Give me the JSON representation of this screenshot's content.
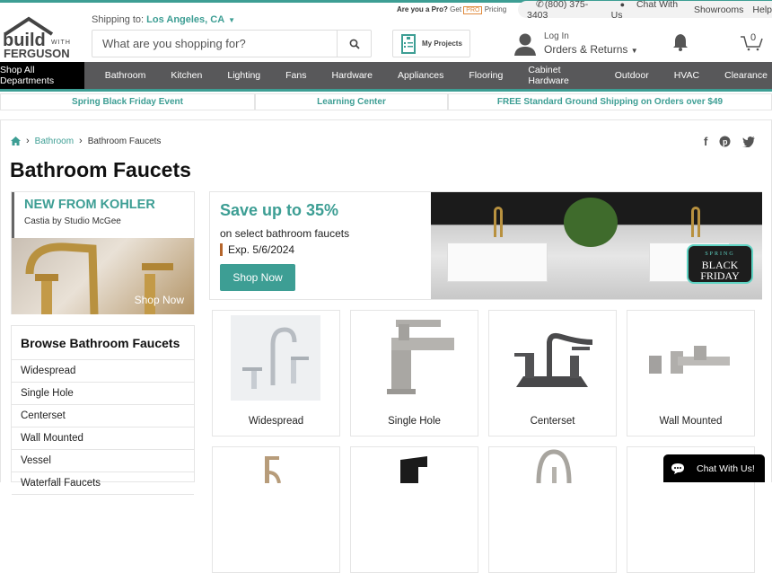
{
  "brand": {
    "line1": "build",
    "line2": "WITH",
    "line3": "FERGUSON",
    "accent": "#3d9e94"
  },
  "shipping": {
    "label": "Shipping to:",
    "location": "Los Angeles, CA"
  },
  "search": {
    "placeholder": "What are you shopping for?",
    "value": ""
  },
  "utility": {
    "pro_question": "Are you a Pro?",
    "pro_get": "Get",
    "pro_badge": "PRO",
    "pro_pricing": "Pricing",
    "phone": "(800) 375-3403",
    "chat": "Chat With Us",
    "showrooms": "Showrooms",
    "help": "Help"
  },
  "header": {
    "projects": "My Projects",
    "login": "Log In",
    "orders": "Orders & Returns",
    "cart_count": "0"
  },
  "nav": {
    "all": "Shop All Departments",
    "items": [
      "Bathroom",
      "Kitchen",
      "Lighting",
      "Fans",
      "Hardware",
      "Appliances",
      "Flooring",
      "Cabinet Hardware",
      "Outdoor",
      "HVAC",
      "Clearance"
    ]
  },
  "promo": [
    "Spring Black Friday Event",
    "Learning Center",
    "FREE Standard Ground Shipping on Orders over $49"
  ],
  "breadcrumb": {
    "parent": "Bathroom",
    "current": "Bathroom Faucets"
  },
  "page_title": "Bathroom Faucets",
  "kohler": {
    "title": "NEW FROM KOHLER",
    "subtitle": "Castia by Studio McGee",
    "cta": "Shop Now"
  },
  "sale": {
    "headline": "Save up to 35%",
    "sub": "on select bathroom faucets",
    "expires": "Exp. 5/6/2024",
    "cta": "Shop Now",
    "badge_top": "SPRING",
    "badge_mid": "BLACK",
    "badge_bot": "FRIDAY"
  },
  "browse": {
    "title": "Browse Bathroom Faucets",
    "items": [
      "Widespread",
      "Single Hole",
      "Centerset",
      "Wall Mounted",
      "Vessel",
      "Waterfall Faucets"
    ]
  },
  "categories": [
    "Widespread",
    "Single Hole",
    "Centerset",
    "Wall Mounted"
  ],
  "chat_widget": "Chat With Us!"
}
